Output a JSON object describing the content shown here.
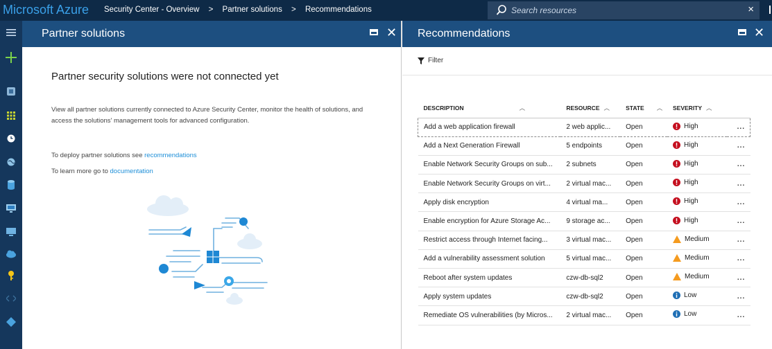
{
  "topbar": {
    "brand": "Microsoft Azure",
    "breadcrumbs": [
      "Security Center - Overview",
      "Partner solutions",
      "Recommendations"
    ],
    "separator": ">",
    "search_placeholder": "Search resources",
    "close_label": "×"
  },
  "colors": {
    "topbar": "#0e2a47",
    "blade_header": "#1d4f80",
    "leftnav": "#15375c",
    "link": "#1e8fd8",
    "high": "#c50f1f",
    "medium": "#f59b1f",
    "low": "#1f6fb5"
  },
  "leftnav": {
    "icons": [
      "hamburger-icon",
      "plus-icon",
      "security-center-icon",
      "dashboard-grid-icon",
      "clock-icon",
      "globe-icon",
      "sql-database-icon",
      "virtual-machine-icon",
      "monitor-icon",
      "cloud-service-icon",
      "key-icon",
      "code-icon",
      "diamond-icon"
    ]
  },
  "partner": {
    "title": "Partner solutions",
    "heading": "Partner security solutions were not connected yet",
    "description": "View all partner solutions currently connected to Azure Security Center, monitor the health of solutions, and access the solutions' management tools for advanced configuration.",
    "deploy_text": "To deploy partner solutions see ",
    "deploy_link": "recommendations",
    "learn_text": "To learn more go to ",
    "learn_link": "documentation"
  },
  "recommendations": {
    "title": "Recommendations",
    "filter_label": "Filter",
    "columns": {
      "description": "DESCRIPTION",
      "resource": "RESOURCE",
      "state": "STATE",
      "severity": "SEVERITY"
    },
    "more_label": "...",
    "rows": [
      {
        "description": "Add a web application firewall",
        "resource": "2 web applic...",
        "state": "Open",
        "severity": "High"
      },
      {
        "description": "Add a Next Generation Firewall",
        "resource": "5 endpoints",
        "state": "Open",
        "severity": "High"
      },
      {
        "description": "Enable Network Security Groups on sub...",
        "resource": "2 subnets",
        "state": "Open",
        "severity": "High"
      },
      {
        "description": "Enable Network Security Groups on virt...",
        "resource": "2 virtual mac...",
        "state": "Open",
        "severity": "High"
      },
      {
        "description": "Apply disk encryption",
        "resource": "4 virtual ma...",
        "state": "Open",
        "severity": "High"
      },
      {
        "description": "Enable encryption for Azure Storage Ac...",
        "resource": "9 storage ac...",
        "state": "Open",
        "severity": "High"
      },
      {
        "description": "Restrict access through Internet facing...",
        "resource": "3 virtual mac...",
        "state": "Open",
        "severity": "Medium"
      },
      {
        "description": "Add a vulnerability assessment solution",
        "resource": "5 virtual mac...",
        "state": "Open",
        "severity": "Medium"
      },
      {
        "description": "Reboot after system updates",
        "resource": "czw-db-sql2",
        "state": "Open",
        "severity": "Medium"
      },
      {
        "description": "Apply system updates",
        "resource": "czw-db-sql2",
        "state": "Open",
        "severity": "Low"
      },
      {
        "description": "Remediate OS vulnerabilities (by Micros...",
        "resource": "2 virtual mac...",
        "state": "Open",
        "severity": "Low"
      }
    ]
  }
}
